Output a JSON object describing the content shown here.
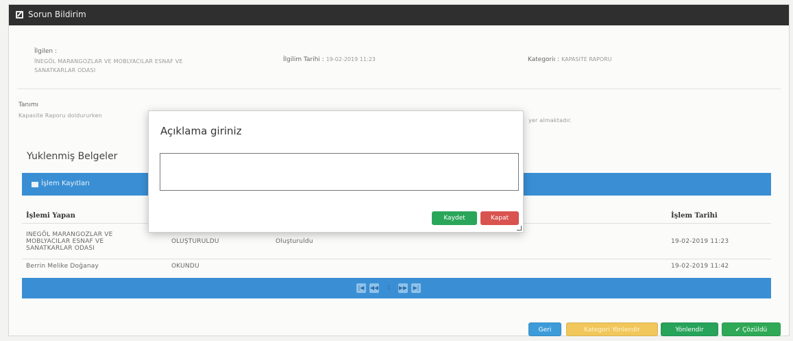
{
  "header": {
    "title": "Sorun Bildirim"
  },
  "info": {
    "ilgili_label": "İlgilen :",
    "ilgili_value_line1": "İNEGÖL MARANGOZLAR VE MOBLYACILAR ESNAF VE",
    "ilgili_value_line2": "SANATKARLAR ODASI",
    "tarih_label": "İlgilim Tarihi :",
    "tarih_value": "19-02-2019 11:23",
    "kategori_label": "Kategoriı :",
    "kategori_value": "KAPASITE RAPORU",
    "tanim_label": "Tanımı",
    "tanim_text_left": "Kapasite Raporu doldururken",
    "tanim_text_right": "yer almaktadır."
  },
  "docs": {
    "title": "Yuklenmiş Belgeler"
  },
  "logs": {
    "title": "İşlem Kayıtları",
    "columns": {
      "islem_yapan": "İşlemi Yapan",
      "islem_tarihi": "İşlem Tarihi"
    },
    "rows": [
      {
        "actor_l1": "INEGÖL MARANGOZLAR VE",
        "actor_l2": "MOBLYACILAR ESNAF VE",
        "actor_l3": "SANATKARLAR ODASI",
        "status": "OLUŞTURULDU",
        "desc": "Oluşturuldu",
        "date": "19-02-2019 11:23"
      },
      {
        "actor_l1": "Berrin Melike Doğanay",
        "status": "OKUNDU",
        "desc": "",
        "date": "19-02-2019 11:42"
      }
    ],
    "pager": {
      "first": "|◀",
      "prev": "◀◀",
      "page": "1",
      "next": "▶▶",
      "last": "▶|"
    }
  },
  "actions": {
    "geri": "Geri",
    "kategori": "Kategori Yönlendir",
    "yonlendir": "Yönlendir",
    "cozuldu": "✔ Çözüldü"
  },
  "modal": {
    "title": "Açıklama giriniz",
    "textarea_value": "",
    "save": "Kaydet",
    "close": "Kapat"
  }
}
